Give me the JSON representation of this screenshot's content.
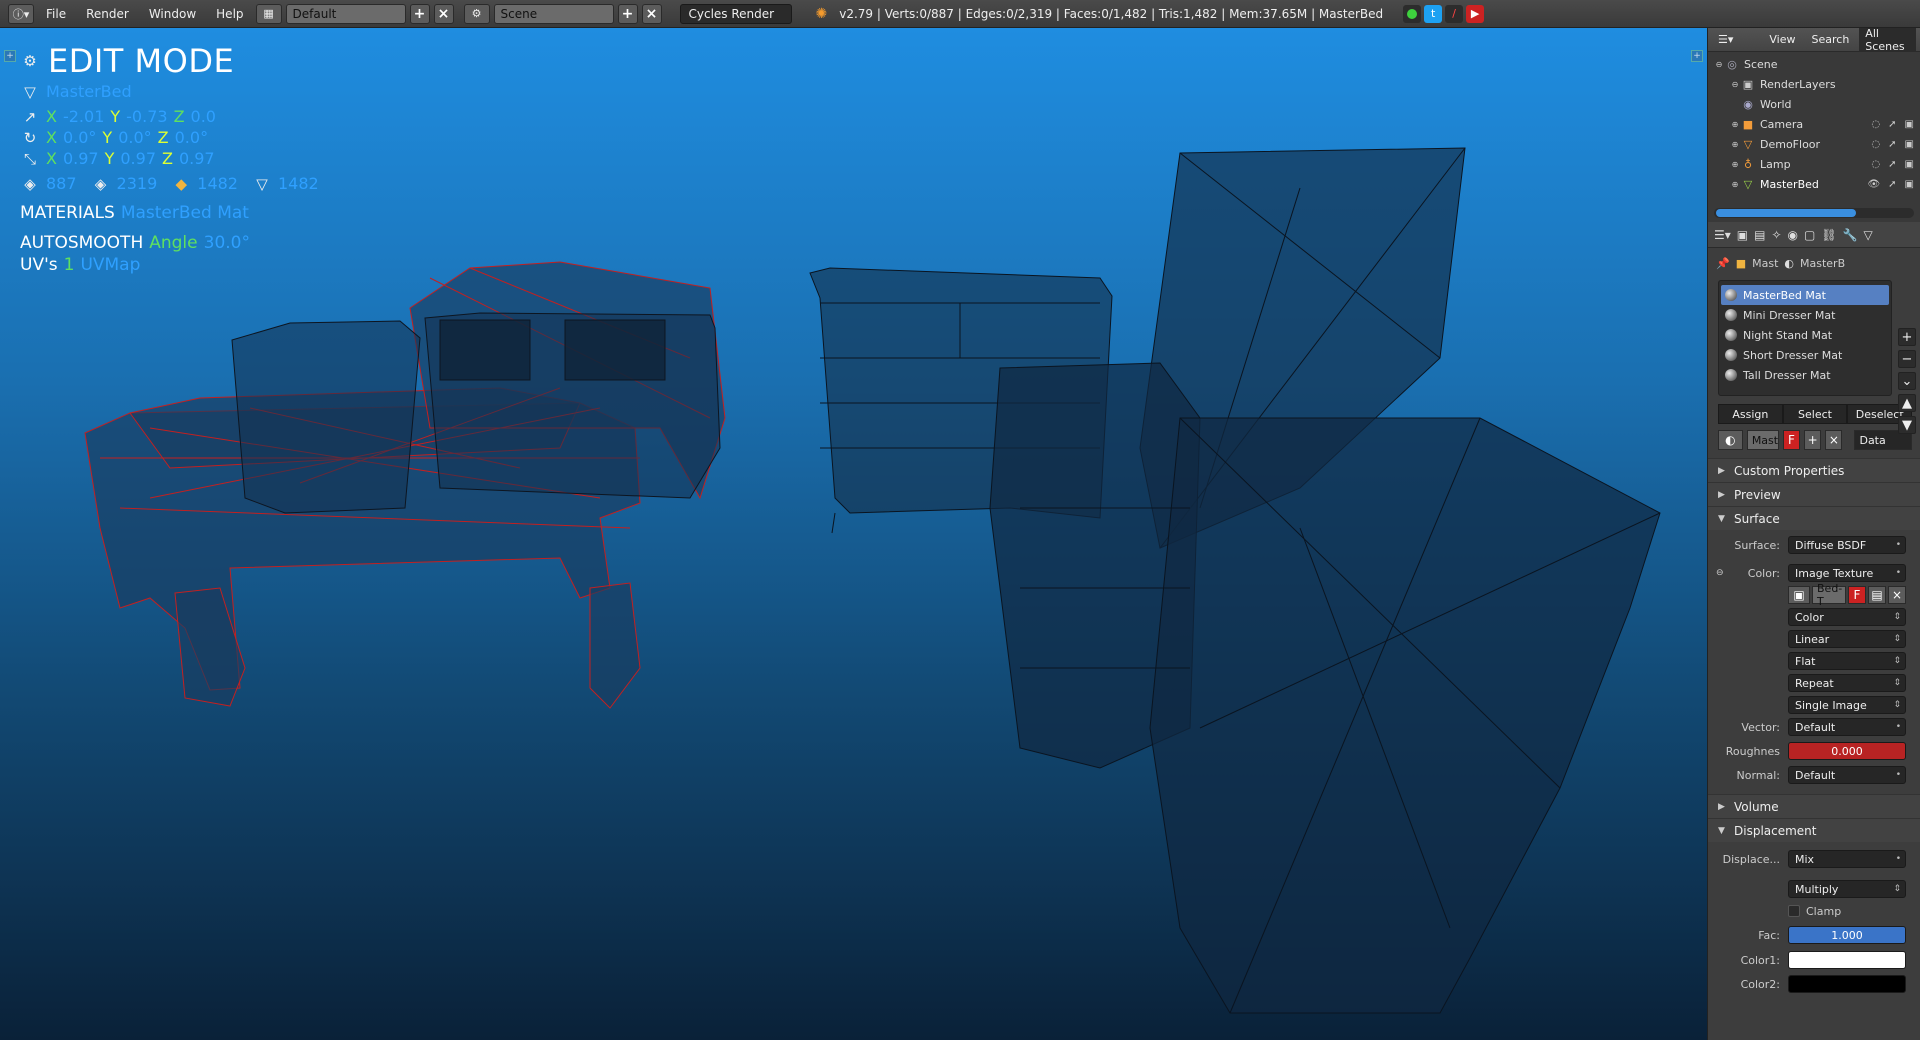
{
  "topbar": {
    "menus": [
      "File",
      "Render",
      "Window",
      "Help"
    ],
    "layout": "Default",
    "scene": "Scene",
    "engine": "Cycles Render",
    "stats": "v2.79 | Verts:0/887 | Edges:0/2,319 | Faces:0/1,482 | Tris:1,482 | Mem:37.65M | MasterBed"
  },
  "viewport": {
    "mode": "EDIT MODE",
    "object": "MasterBed",
    "location": {
      "x": "-2.01",
      "y": "-0.73",
      "z": "0.0"
    },
    "rotation": {
      "x": "0.0°",
      "y": "0.0°",
      "z": "0.0°"
    },
    "scale": {
      "x": "0.97",
      "y": "0.97",
      "z": "0.97"
    },
    "counts": {
      "verts": "887",
      "edges": "2319",
      "faces": "1482",
      "tris": "1482"
    },
    "materials_label": "MATERIALS",
    "materials_value": "MasterBed Mat",
    "autosmooth_label": "AUTOSMOOTH",
    "angle_label": "Angle",
    "angle_value": "30.0°",
    "uvs_label": "UV's",
    "uvs_count": "1",
    "uvs_name": "UVMap"
  },
  "outliner": {
    "tabs": [
      "View",
      "Search",
      "All Scenes"
    ],
    "items": [
      {
        "label": "Scene",
        "icon": "scene-icon"
      },
      {
        "label": "RenderLayers",
        "icon": "renderlayers-icon"
      },
      {
        "label": "World",
        "icon": "world-icon"
      },
      {
        "label": "Camera",
        "icon": "camera-icon"
      },
      {
        "label": "DemoFloor",
        "icon": "mesh-icon"
      },
      {
        "label": "Lamp",
        "icon": "lamp-icon"
      },
      {
        "label": "MasterBed",
        "icon": "mesh-icon"
      }
    ]
  },
  "properties": {
    "context": [
      "Mast",
      "MasterB"
    ],
    "materials": [
      "MasterBed Mat",
      "Mini Dresser Mat",
      "Night Stand Mat",
      "Short Dresser Mat",
      "Tall Dresser Mat"
    ],
    "buttons": [
      "Assign",
      "Select",
      "Deselect"
    ],
    "slot": {
      "name": "Mast",
      "f": "F",
      "link": "Data"
    },
    "panels": {
      "custom": "Custom Properties",
      "preview": "Preview",
      "surface": "Surface",
      "volume": "Volume",
      "displacement": "Displacement"
    },
    "surface": {
      "surface_label": "Surface:",
      "surface_value": "Diffuse BSDF",
      "color_label": "Color:",
      "color_value": "Image Texture",
      "image_name": "Bed-T",
      "image_f": "F",
      "opts": [
        "Color",
        "Linear",
        "Flat",
        "Repeat",
        "Single Image"
      ],
      "vector_label": "Vector:",
      "vector_value": "Default",
      "roughness_label": "Roughnes",
      "roughness_value": "0.000",
      "normal_label": "Normal:",
      "normal_value": "Default"
    },
    "displacement": {
      "label": "Displace...",
      "value": "Mix",
      "blend": "Multiply",
      "clamp": "Clamp",
      "fac_label": "Fac:",
      "fac_value": "1.000",
      "color1_label": "Color1:",
      "color2_label": "Color2:"
    }
  }
}
